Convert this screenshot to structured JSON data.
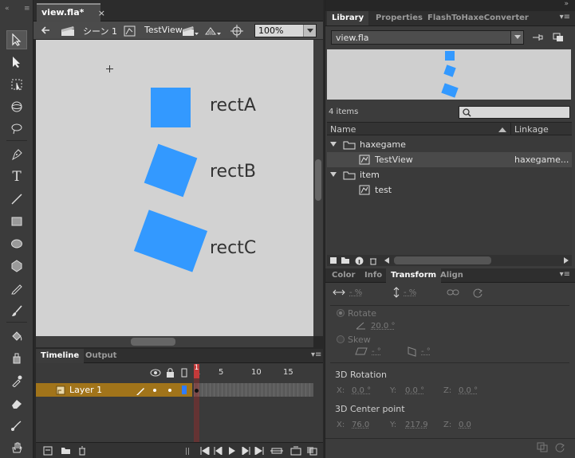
{
  "document": {
    "tab_title": "view.fla*",
    "close_glyph": "×"
  },
  "edit_bar": {
    "scene_label": "シーン 1",
    "symbol_label": "TestView",
    "zoom": "100%"
  },
  "stage": {
    "background": "#d2d2d2",
    "object_color": "#3399ff",
    "objects": [
      {
        "label": "rectA",
        "rotation_deg": 0
      },
      {
        "label": "rectB",
        "rotation_deg": 20
      },
      {
        "label": "rectC",
        "rotation_deg": 20
      }
    ]
  },
  "timeline": {
    "tabs": [
      {
        "label": "Timeline",
        "active": true
      },
      {
        "label": "Output",
        "active": false
      }
    ],
    "frame_numbers": [
      "1",
      "5",
      "10",
      "15"
    ],
    "layer_name": "Layer 1",
    "current_frame": "1"
  },
  "library": {
    "tabs": [
      {
        "label": "Library",
        "active": true
      },
      {
        "label": "Properties",
        "active": false
      },
      {
        "label": "FlashToHaxeConverter",
        "active": false
      }
    ],
    "document_select": "view.fla",
    "item_count": "4 items",
    "columns": {
      "name": "Name",
      "linkage": "Linkage"
    },
    "items": [
      {
        "name": "haxegame",
        "type": "folder",
        "linkage": "",
        "indent": 0
      },
      {
        "name": "TestView",
        "type": "movieclip",
        "linkage": "haxegame...",
        "indent": 1,
        "selected": true
      },
      {
        "name": "item",
        "type": "folder",
        "linkage": "",
        "indent": 0
      },
      {
        "name": "test",
        "type": "movieclip",
        "linkage": "",
        "indent": 1
      }
    ]
  },
  "transform": {
    "tabs": [
      {
        "label": "Color",
        "active": false
      },
      {
        "label": "Info",
        "active": false
      },
      {
        "label": "Transform",
        "active": true
      },
      {
        "label": "Align",
        "active": false
      }
    ],
    "scale_w": "- %",
    "scale_h": "- %",
    "rotate_label": "Rotate",
    "rotate_value": "20.0 °",
    "skew_label": "Skew",
    "skew_h": "- °",
    "skew_v": "- °",
    "rotation_3d_title": "3D Rotation",
    "rotation_3d": {
      "x_label": "X:",
      "x": "0.0 °",
      "y_label": "Y:",
      "y": "0.0 °",
      "z_label": "Z:",
      "z": "0.0 °"
    },
    "center_3d_title": "3D Center point",
    "center_3d": {
      "x_label": "X:",
      "x": "76.0",
      "y_label": "Y:",
      "y": "217.9",
      "z_label": "Z:",
      "z": "0.0"
    }
  }
}
